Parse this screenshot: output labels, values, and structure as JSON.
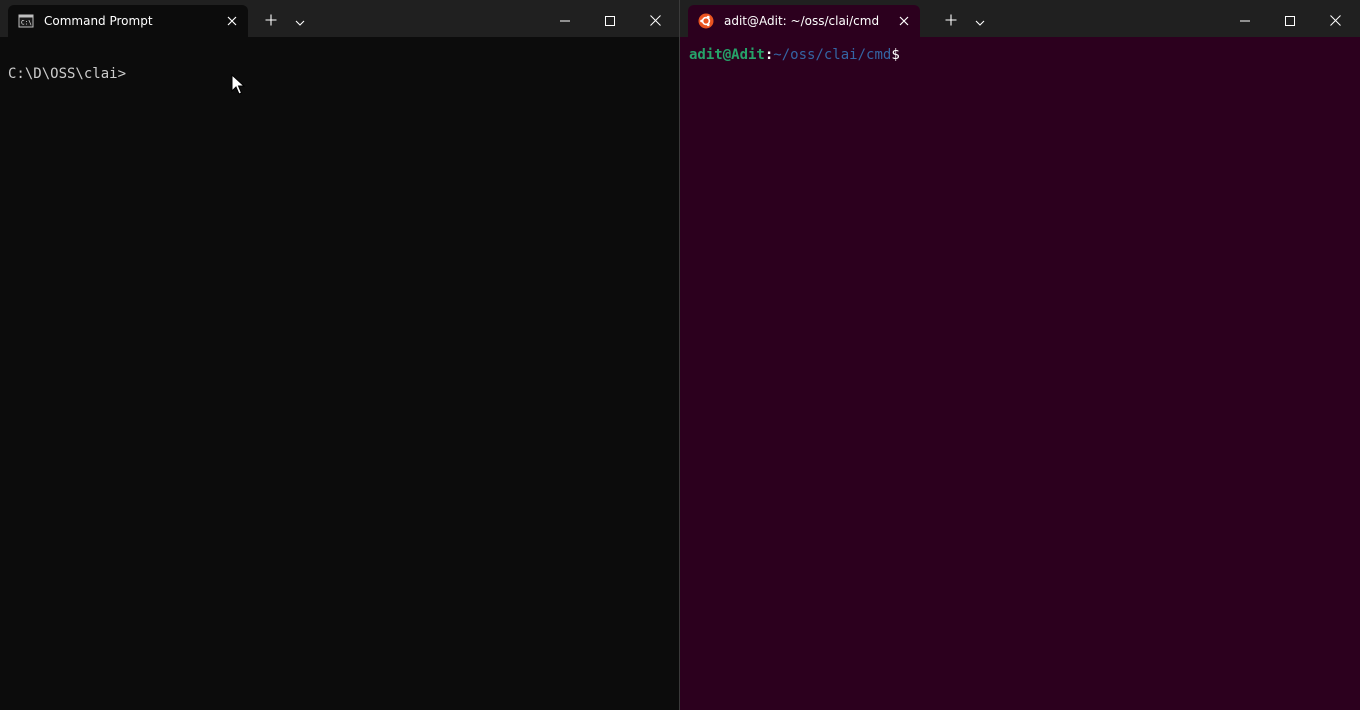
{
  "left_window": {
    "tab_title": "Command Prompt",
    "tab_icon": "cmd-icon",
    "close_tab_icon": "close-icon",
    "new_tab_icon": "plus-icon",
    "dropdown_icon": "chevron-down-icon",
    "prompt": "C:\\D\\OSS\\clai>"
  },
  "right_window": {
    "tab_title": "adit@Adit: ~/oss/clai/cmd",
    "tab_icon": "ubuntu-icon",
    "close_tab_icon": "close-icon",
    "new_tab_icon": "plus-icon",
    "dropdown_icon": "chevron-down-icon",
    "prompt_user": "adit@Adit",
    "prompt_colon": ":",
    "prompt_path": "~/oss/clai/cmd",
    "prompt_symbol": "$"
  },
  "colors": {
    "titlebar": "#202020",
    "cmd_background": "#0c0c0c",
    "ubuntu_background": "#2c001e",
    "ubuntu_user": "#26a269",
    "ubuntu_path": "#3465a4",
    "ubuntu_brand": "#e95420"
  }
}
